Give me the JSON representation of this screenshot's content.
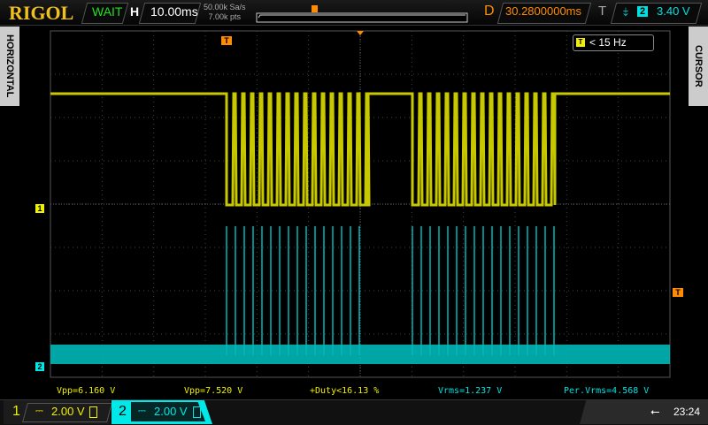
{
  "brand": "RIGOL",
  "status": "WAIT",
  "timebase": {
    "label": "H",
    "value": "10.00ms"
  },
  "sampling": {
    "rate": "50.00k Sa/s",
    "points": "7.00k pts"
  },
  "delay": {
    "label": "D",
    "value": "30.2800000ms"
  },
  "trigger": {
    "label": "T",
    "source": "2",
    "level": "3.40 V",
    "edge": "falling",
    "freq": "< 15 Hz"
  },
  "side_left": "HORIZONTAL",
  "side_right": "CURSOR",
  "measurements": [
    {
      "text": "Vpp=6.160 V",
      "color": "#f0f000"
    },
    {
      "text": "Vpp=7.520 V",
      "color": "#f0f000"
    },
    {
      "text": "+Duty<16.13 %",
      "color": "#f0f000"
    },
    {
      "text": "Vrms=1.237 V",
      "color": "#00e0e0"
    },
    {
      "text": "Per.Vrms=4.568 V",
      "color": "#00e0e0"
    }
  ],
  "channels": [
    {
      "num": "1",
      "coupling": "⎓",
      "scale": "2.00 V",
      "color": "#f0f000"
    },
    {
      "num": "2",
      "coupling": "⎓",
      "scale": "2.00 V",
      "color": "#00e8e8"
    }
  ],
  "clock": "23:24",
  "colors": {
    "ch1": "#c8c800",
    "ch2": "#00b8b8",
    "trigger": "#ff8c00"
  }
}
